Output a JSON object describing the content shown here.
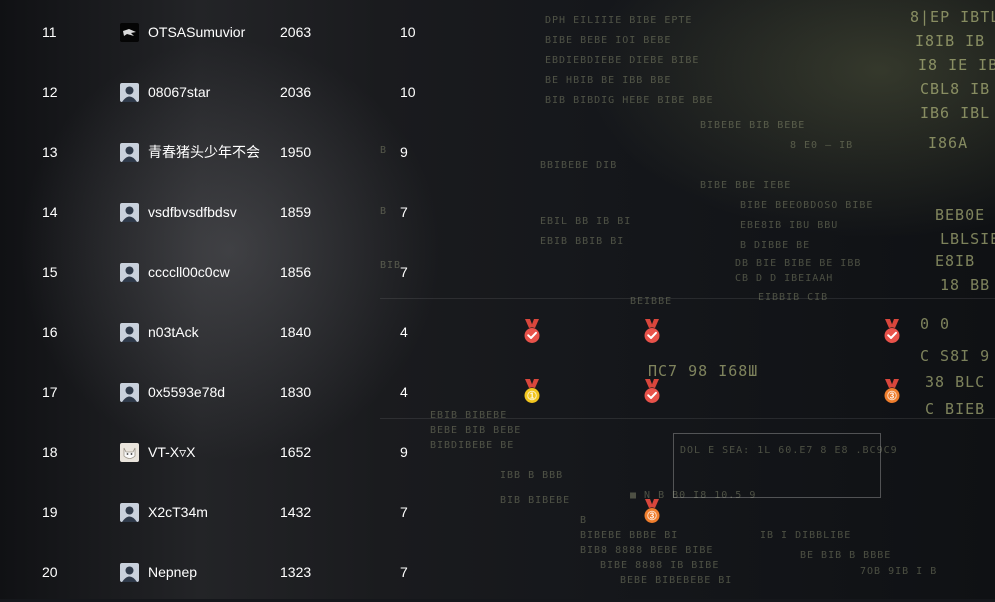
{
  "rows": [
    {
      "rank": "11",
      "name": "OTSASumuvior",
      "score": "2063",
      "solved": "10",
      "avatar": "dark-logo",
      "medals": []
    },
    {
      "rank": "12",
      "name": "08067star",
      "score": "2036",
      "solved": "10",
      "avatar": "default",
      "medals": []
    },
    {
      "rank": "13",
      "name": "青春猪头少年不会",
      "score": "1950",
      "solved": "9",
      "avatar": "default",
      "medals": []
    },
    {
      "rank": "14",
      "name": "vsdfbvsdfbdsv",
      "score": "1859",
      "solved": "7",
      "avatar": "default",
      "medals": []
    },
    {
      "rank": "15",
      "name": "ccccll00c0cw",
      "score": "1856",
      "solved": "7",
      "avatar": "default",
      "medals": []
    },
    {
      "rank": "16",
      "name": "n03tAck",
      "score": "1840",
      "solved": "4",
      "avatar": "default",
      "medals": [
        {
          "col": 0,
          "type": "check"
        },
        {
          "col": 1,
          "type": "check"
        },
        {
          "col": 3,
          "type": "check"
        }
      ]
    },
    {
      "rank": "17",
      "name": "0x5593e78d",
      "score": "1830",
      "solved": "4",
      "avatar": "default",
      "medals": [
        {
          "col": 0,
          "type": "first"
        },
        {
          "col": 1,
          "type": "check"
        },
        {
          "col": 3,
          "type": "third"
        }
      ]
    },
    {
      "rank": "18",
      "name": "VT-X▿X",
      "score": "1652",
      "solved": "9",
      "avatar": "cat",
      "medals": []
    },
    {
      "rank": "19",
      "name": "X2cT34m",
      "score": "1432",
      "solved": "7",
      "avatar": "default",
      "medals": [
        {
          "col": 1,
          "type": "third"
        }
      ]
    },
    {
      "rank": "20",
      "name": "Nepnep",
      "score": "1323",
      "solved": "7",
      "avatar": "default",
      "medals": []
    }
  ],
  "medal_labels": {
    "first": "1",
    "third": "3"
  },
  "colors": {
    "ribbon": "#d9463c",
    "check_medal": "#e8524a",
    "first_medal": "#f2c51d",
    "third_medal": "#ef7d2c",
    "text": "#ffffff"
  }
}
